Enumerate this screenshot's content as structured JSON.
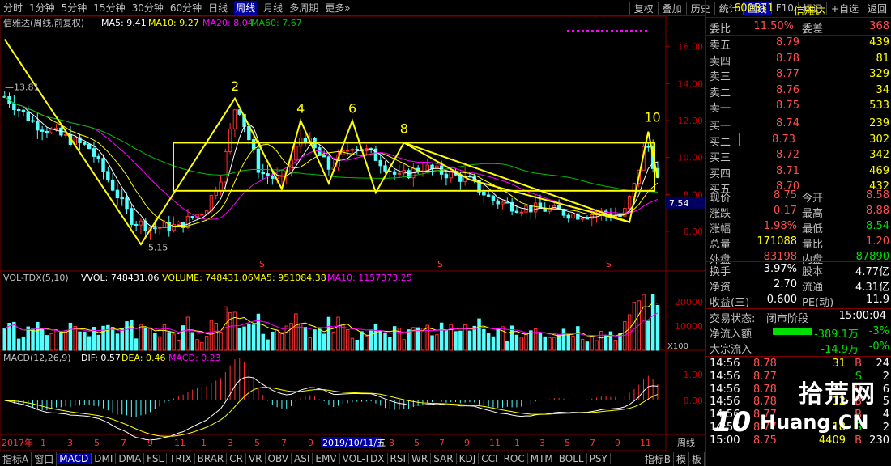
{
  "periods": [
    "分时",
    "1分钟",
    "5分钟",
    "15分钟",
    "30分钟",
    "60分钟",
    "日线",
    "周线",
    "月线",
    "多周期",
    "更多»"
  ],
  "active_period": "周线",
  "tools": [
    "复权",
    "叠加",
    "历史",
    "统计",
    "画线",
    "F10",
    "标记",
    "+自选",
    "返回"
  ],
  "active_tool": "画线",
  "main_legend": {
    "name": "信雅达(周线,前复权)",
    "ma5": "MA5: 9.41",
    "ma10": "MA10: 9.27",
    "ma20": "MA20: 8.04",
    "ma60": "MA60: 7.67"
  },
  "vol_legend": {
    "name": "VOL-TDX(5,10)",
    "vvol": "VVOL: 748431.06",
    "volume": "VOLUME: 748431.06",
    "ma5": "MA5: 951084.38",
    "ma10": "MA10: 1157373.25"
  },
  "macd_legend": {
    "name": "MACD(12,26,9)",
    "dif": "DIF: 0.57",
    "dea": "DEA: 0.46",
    "macd": "MACD: 0.23"
  },
  "price_axis": [
    "16.00",
    "14.00",
    "12.00",
    "10.00",
    "8.00",
    "6.00"
  ],
  "current_tag": "7.54",
  "vol_axis": [
    "20000",
    "10000"
  ],
  "vol_unit": "X100",
  "macd_axis": [
    "1.00",
    "0.00"
  ],
  "annotations": {
    "high_label": "13.81",
    "low_label": "5.15",
    "waves": [
      "2",
      "4",
      "6",
      "8",
      "10"
    ],
    "s_marks": [
      "S",
      "S",
      "S"
    ]
  },
  "chart_data": {
    "type": "candlestick",
    "wave_points": [
      {
        "label": "2",
        "price": 13.1
      },
      {
        "label": "4",
        "price": 11.9
      },
      {
        "label": "6",
        "price": 11.9
      },
      {
        "label": "8",
        "price": 10.8
      },
      {
        "label": "10",
        "price": 11.4
      }
    ],
    "box": {
      "top": 10.8,
      "bottom": 8.2
    },
    "high": 13.81,
    "low": 5.15,
    "last": 8.75
  },
  "date_axis": {
    "year": "2017年",
    "months": [
      "1",
      "3",
      "5",
      "7",
      "9",
      "11",
      "1",
      "3",
      "5",
      "7",
      "9"
    ],
    "cursor": "2019/10/11/五",
    "months2": [
      "3",
      "5",
      "7",
      "9",
      "11",
      "1",
      "3",
      "5",
      "7",
      "9",
      "11"
    ],
    "tag": "周线"
  },
  "quote": {
    "code": "600571",
    "name": "信雅达",
    "weibi_label": "委比",
    "weibi": "11.50%",
    "weicha_label": "委差",
    "weicha": "368",
    "asks": [
      {
        "l": "卖五",
        "p": "8.79",
        "v": "439"
      },
      {
        "l": "卖四",
        "p": "8.78",
        "v": "81"
      },
      {
        "l": "卖三",
        "p": "8.77",
        "v": "329"
      },
      {
        "l": "卖二",
        "p": "8.76",
        "v": "34"
      },
      {
        "l": "卖一",
        "p": "8.75",
        "v": "533"
      }
    ],
    "bids": [
      {
        "l": "买一",
        "p": "8.74",
        "v": "239"
      },
      {
        "l": "买二",
        "p": "8.73",
        "v": "302"
      },
      {
        "l": "买三",
        "p": "8.72",
        "v": "342"
      },
      {
        "l": "买四",
        "p": "8.71",
        "v": "469"
      },
      {
        "l": "买五",
        "p": "8.70",
        "v": "432"
      }
    ],
    "stats": [
      {
        "a": "现价",
        "av": "8.75",
        "b": "今开",
        "bv": "8.58",
        "ac": "red",
        "bc": "red"
      },
      {
        "a": "涨跌",
        "av": "0.17",
        "b": "最高",
        "bv": "8.88",
        "ac": "red",
        "bc": "red"
      },
      {
        "a": "涨幅",
        "av": "1.98%",
        "b": "最低",
        "bv": "8.54",
        "ac": "red",
        "bc": "grn"
      },
      {
        "a": "总量",
        "av": "171088",
        "b": "量比",
        "bv": "1.20",
        "ac": "yel",
        "bc": "red"
      },
      {
        "a": "外盘",
        "av": "83198",
        "b": "内盘",
        "bv": "87890",
        "ac": "red",
        "bc": "grn"
      }
    ],
    "stats2": [
      {
        "a": "换手",
        "av": "3.97%",
        "b": "股本",
        "bv": "4.77亿"
      },
      {
        "a": "净资",
        "av": "2.70",
        "b": "流通",
        "bv": "4.31亿"
      },
      {
        "a": "收益(三)",
        "av": "0.600",
        "b": "PE(动)",
        "bv": "11.9"
      }
    ],
    "trade_state_label": "交易状态:",
    "trade_state": "闭市阶段",
    "trade_time": "15:00:04",
    "flow": [
      {
        "l": "净流入额",
        "v": "-389.1万",
        "p": "-3%"
      },
      {
        "l": "大宗流入",
        "v": "-14.9万",
        "p": "-0%"
      }
    ],
    "ticks": [
      {
        "t": "14:56",
        "p": "8.78",
        "v": "31",
        "d": "B",
        "n": "24"
      },
      {
        "t": "14:56",
        "p": "8.77",
        "v": "",
        "d": "S",
        "n": "2"
      },
      {
        "t": "14:56",
        "p": "8.78",
        "v": "",
        "d": "B",
        "n": "6"
      },
      {
        "t": "14:56",
        "p": "8.78",
        "v": "32",
        "d": "B",
        "n": "5"
      },
      {
        "t": "14:56",
        "p": "8.77",
        "v": "",
        "d": "B",
        "n": "4"
      },
      {
        "t": "14:56",
        "p": "8.77",
        "v": "18",
        "d": "S",
        "n": "2"
      },
      {
        "t": "15:00",
        "p": "8.75",
        "v": "4409",
        "d": "B",
        "n": "230"
      }
    ]
  },
  "watermark": {
    "title": "拾荒网",
    "url": "Huang.CN",
    "num": "10"
  },
  "bottom_tabs": [
    "指标A",
    "窗口",
    "MACD",
    "DMI",
    "DMA",
    "FSL",
    "TRIX",
    "BRAR",
    "CR",
    "VR",
    "OBV",
    "ASI",
    "EMV",
    "VOL-TDX",
    "RSI",
    "WR",
    "SAR",
    "KDJ",
    "CCI",
    "ROC",
    "MTM",
    "BOLL",
    "PSY"
  ],
  "bottom_active": "MACD",
  "bottom_right": [
    "指标B",
    "模",
    "板"
  ],
  "colors": {
    "up": "#ff3232",
    "down": "#54ffff",
    "yellow": "#ffff00",
    "ma5": "#ffffff",
    "ma10": "#ffff00",
    "ma20": "#ff00ff",
    "ma60": "#00c000"
  }
}
